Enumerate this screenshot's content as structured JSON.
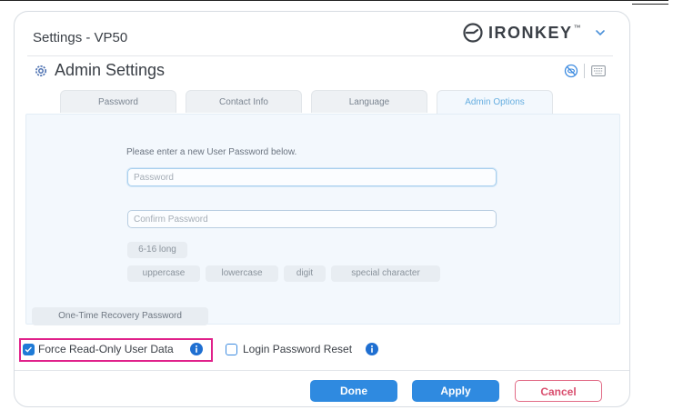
{
  "window": {
    "title": "Settings - VP50",
    "brand": "IRONKEY",
    "brand_tm": "™"
  },
  "header": {
    "title": "Admin Settings"
  },
  "tabs": [
    {
      "label": "Password",
      "active": false
    },
    {
      "label": "Contact Info",
      "active": false
    },
    {
      "label": "Language",
      "active": false
    },
    {
      "label": "Admin Options",
      "active": true
    }
  ],
  "panel": {
    "prompt": "Please enter a new User Password below.",
    "password_placeholder": "Password",
    "confirm_placeholder": "Confirm Password",
    "rules": [
      "6-16 long",
      "uppercase",
      "lowercase",
      "digit",
      "special character"
    ],
    "recovery_label": "One-Time Recovery Password"
  },
  "options": [
    {
      "label": "Force Read-Only User Data",
      "checked": true
    },
    {
      "label": "Login Password Reset",
      "checked": false
    }
  ],
  "buttons": {
    "done": "Done",
    "apply": "Apply",
    "cancel": "Cancel"
  },
  "colors": {
    "accent": "#2f8ae0",
    "highlight": "#e0218a",
    "cancel_border": "#e26b86"
  }
}
